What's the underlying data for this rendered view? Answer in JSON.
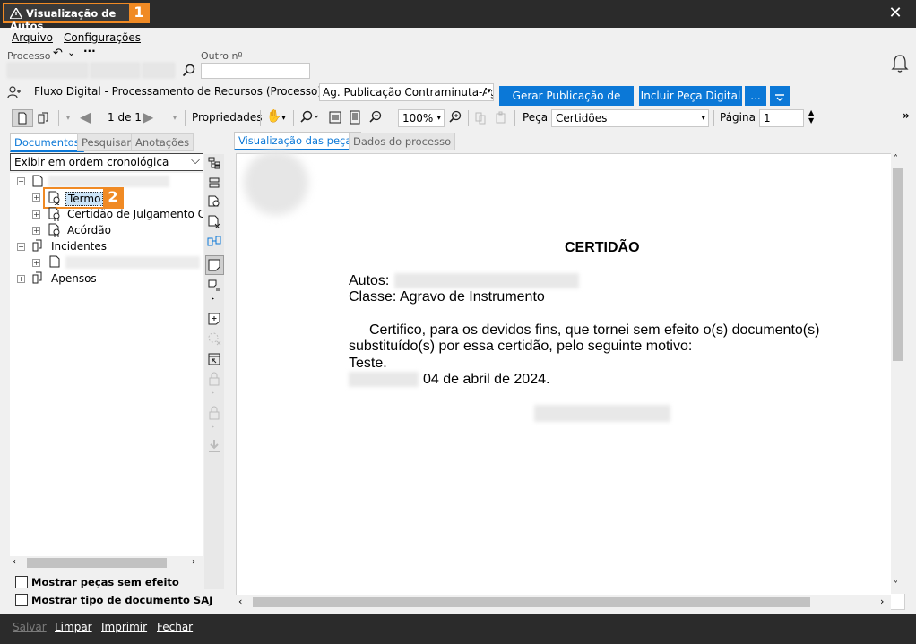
{
  "window": {
    "title": "Visualização de Autos",
    "badge1": "1",
    "badge2": "2"
  },
  "menu": {
    "items": [
      "Arquivo",
      "Configurações"
    ]
  },
  "process": {
    "processo_label": "Processo",
    "outro_label": "Outro nº",
    "more": "···"
  },
  "fluxo": {
    "text": "Fluxo Digital - Processamento de Recursos (Processo) - Fila:",
    "fila_value": "Ag. Publicação Contraminuta-Agi",
    "btn_gerar": "Gerar Publicação de Vista",
    "btn_incluir": "Incluir Peça Digital",
    "btn_more": "..."
  },
  "toolbar": {
    "page_indicator": "1 de 1",
    "propriedades": "Propriedades",
    "zoom": "100%",
    "peca_label": "Peça",
    "peca_value": "Certidões",
    "pagina_label": "Página",
    "pagina_value": "1"
  },
  "left_tabs": [
    "Documentos",
    "Pesquisar",
    "Anotações"
  ],
  "order_select": "Exibir em ordem cronológica",
  "tree": {
    "termo": "Termo",
    "certidao": "Certidão de Julgamento Coleg",
    "acordao": "Acórdão",
    "incidentes": "Incidentes",
    "apensos": "Apensos"
  },
  "checkboxes": {
    "sem_efeito": "Mostrar peças sem efeito",
    "tipo_doc": "Mostrar tipo de documento SAJ"
  },
  "right_tabs": [
    "Visualização das peças",
    "Dados do processo"
  ],
  "document": {
    "title": "CERTIDÃO",
    "autos_label": "Autos:",
    "classe": "Classe: Agravo de Instrumento",
    "line1": "Certifico, para os devidos fins, que tornei sem efeito o(s) documento(s)",
    "line2": "substituído(s) por essa certidão, pelo seguinte motivo:",
    "line3": "Teste.",
    "date": "04 de abril de 2024."
  },
  "bottom": {
    "salvar": "Salvar",
    "limpar": "Limpar",
    "imprimir": "Imprimir",
    "fechar": "Fechar"
  },
  "colors": {
    "accent": "#0b78d7",
    "highlight": "#f08a24",
    "titlebar": "#2b2b2b"
  }
}
